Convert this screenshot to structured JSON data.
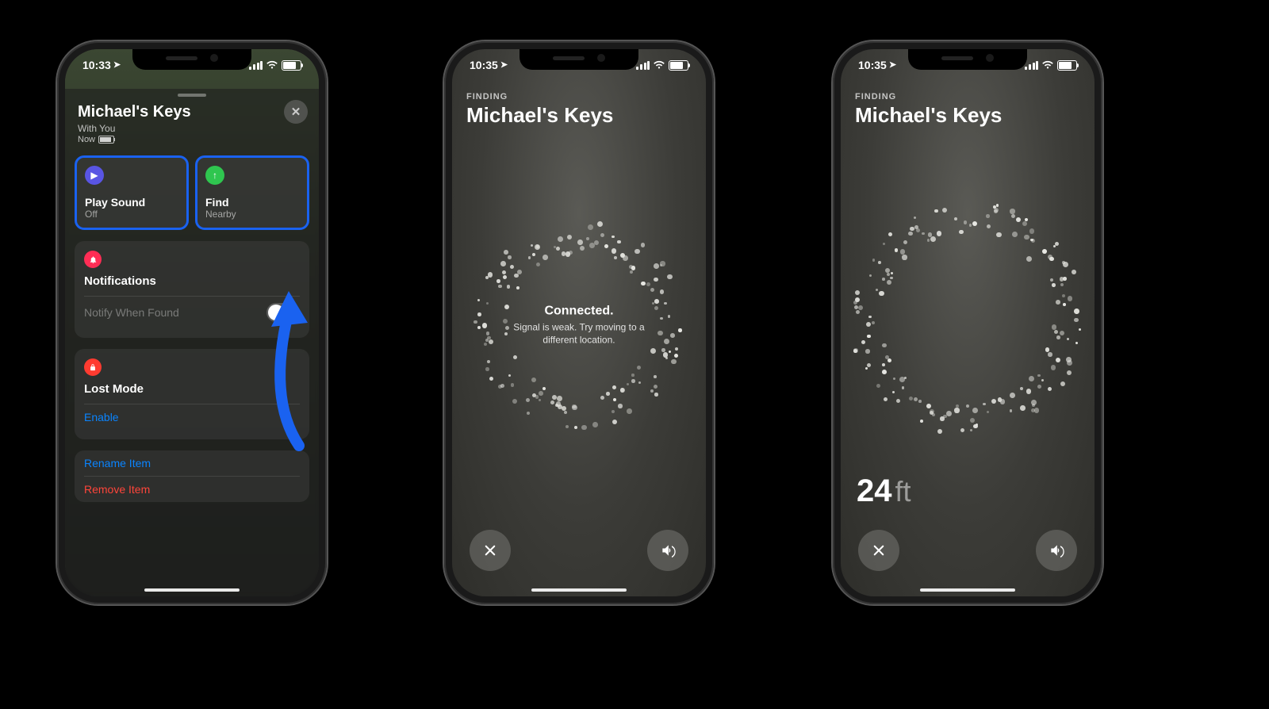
{
  "highlight_color": "#1a62f0",
  "phone1": {
    "time": "10:33",
    "device_name": "Michael's Keys",
    "location_sub": "With You",
    "time_sub": "Now",
    "tiles": {
      "play_sound": {
        "title": "Play Sound",
        "sub": "Off"
      },
      "find": {
        "title": "Find",
        "sub": "Nearby"
      }
    },
    "notifications": {
      "title": "Notifications",
      "option": "Notify When Found",
      "toggle": false
    },
    "lost_mode": {
      "title": "Lost Mode",
      "enable": "Enable"
    },
    "links": {
      "rename": "Rename Item",
      "remove": "Remove Item"
    }
  },
  "phone2": {
    "time": "10:35",
    "finding_label": "FINDING",
    "device_name": "Michael's Keys",
    "message_title": "Connected.",
    "message_body": "Signal is weak. Try moving to a different location."
  },
  "phone3": {
    "time": "10:35",
    "finding_label": "FINDING",
    "device_name": "Michael's Keys",
    "distance_value": "24",
    "distance_unit": "ft"
  }
}
